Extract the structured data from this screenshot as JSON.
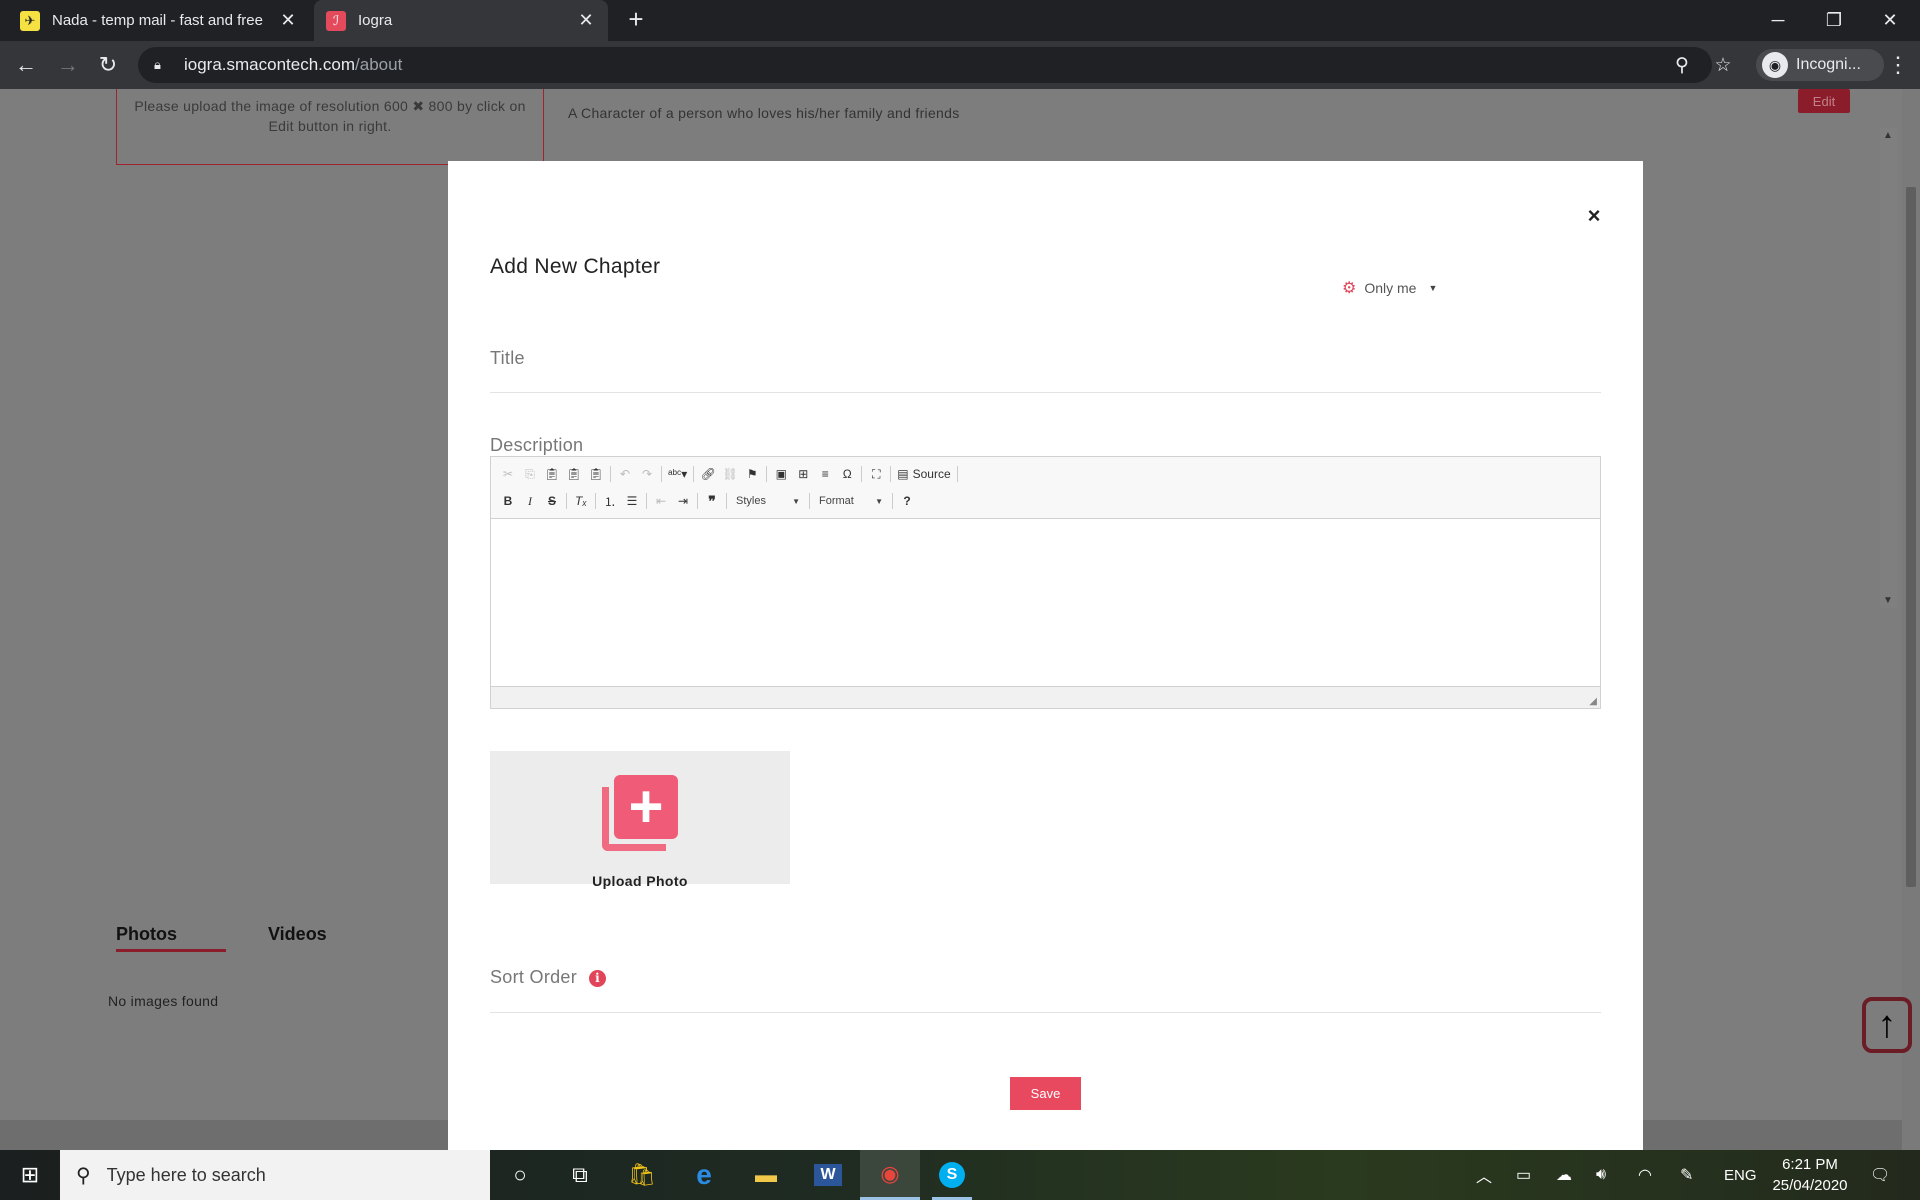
{
  "browser": {
    "tabs": [
      {
        "title": "Nada - temp mail - fast and free",
        "active": false
      },
      {
        "title": "Iogra",
        "active": true
      }
    ],
    "url_host": "iogra.smacontech.com",
    "url_path": "/about",
    "profile_label": "Incogni..."
  },
  "page": {
    "upload_hint": "Please upload the image of resolution 600 ✖ 800 by click on Edit button in right.",
    "about_text": "A Character of a person who loves his/her family and friends",
    "edit_label": "Edit",
    "tabs": [
      {
        "label": "Photos"
      },
      {
        "label": "Videos"
      }
    ],
    "no_images": "No images found"
  },
  "modal": {
    "title": "Add New Chapter",
    "privacy_label": "Only me",
    "title_label": "Title",
    "description_label": "Description",
    "editor": {
      "source_label": "Source",
      "styles_label": "Styles",
      "format_label": "Format"
    },
    "upload_photo_label": "Upload Photo",
    "sort_order_label": "Sort Order",
    "save_label": "Save",
    "accent_color": "#e8495f"
  },
  "taskbar": {
    "search_placeholder": "Type here to search",
    "language": "ENG",
    "time": "6:21 PM",
    "date": "25/04/2020"
  }
}
